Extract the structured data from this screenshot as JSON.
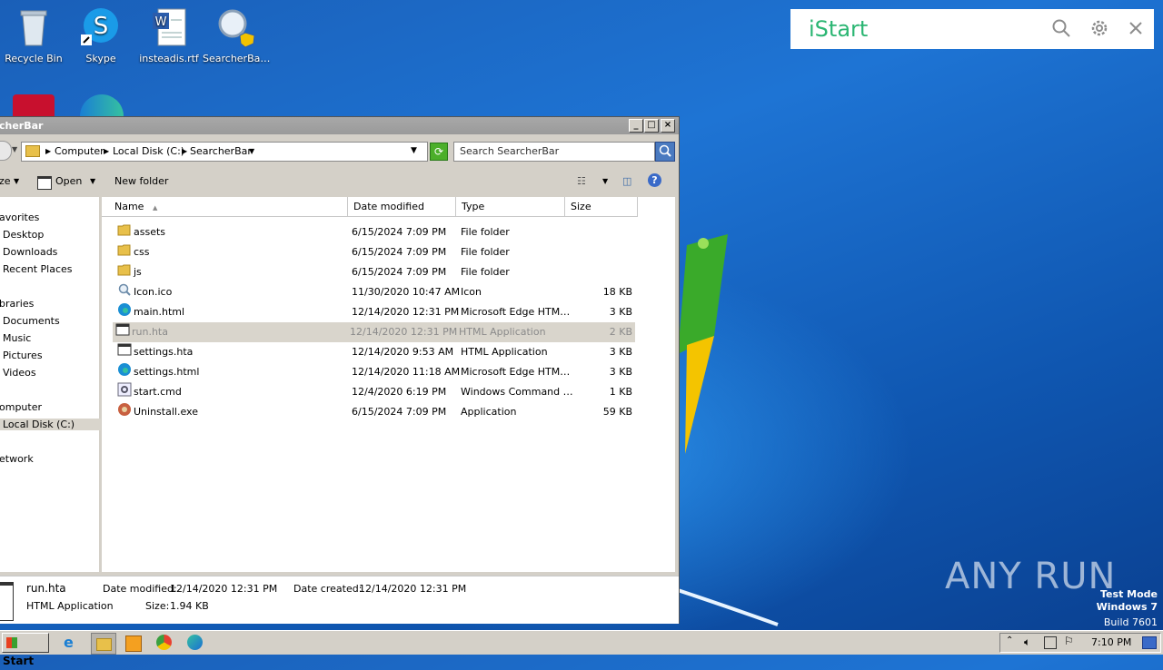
{
  "desktop": {
    "icons": [
      {
        "label": "Recycle Bin",
        "icon": "recycle-bin-icon"
      },
      {
        "label": "Skype",
        "icon": "skype-icon"
      },
      {
        "label": "insteadis.rtf",
        "icon": "word-document-icon"
      },
      {
        "label": "SearcherBa…",
        "icon": "search-shield-icon"
      }
    ]
  },
  "widget": {
    "logo": "iStart",
    "search_icon": "search-icon",
    "settings_icon": "gear-icon",
    "close_icon": "close-icon"
  },
  "window": {
    "title": "cherBar",
    "address": {
      "crumbs": [
        "Computer",
        "Local Disk (C:)",
        "SearcherBar"
      ]
    },
    "search_placeholder": "Search SearcherBar",
    "toolbar": {
      "organize": "ze",
      "open": "Open",
      "new_folder": "New folder"
    },
    "nav": [
      {
        "label": "avorites",
        "indent": false
      },
      {
        "label": "Desktop",
        "indent": true
      },
      {
        "label": "Downloads",
        "indent": true
      },
      {
        "label": "Recent Places",
        "indent": true
      },
      {
        "label": "braries",
        "indent": false
      },
      {
        "label": "Documents",
        "indent": true
      },
      {
        "label": "Music",
        "indent": true
      },
      {
        "label": "Pictures",
        "indent": true
      },
      {
        "label": "Videos",
        "indent": true
      },
      {
        "label": "omputer",
        "indent": false
      },
      {
        "label": "Local Disk (C:)",
        "indent": true,
        "selected": true
      },
      {
        "label": "etwork",
        "indent": false
      }
    ],
    "columns": {
      "name": "Name",
      "date": "Date modified",
      "type": "Type",
      "size": "Size"
    },
    "files": [
      {
        "name": "assets",
        "date": "6/15/2024 7:09 PM",
        "type": "File folder",
        "size": "",
        "icon": "folder-icon"
      },
      {
        "name": "css",
        "date": "6/15/2024 7:09 PM",
        "type": "File folder",
        "size": "",
        "icon": "folder-icon"
      },
      {
        "name": "js",
        "date": "6/15/2024 7:09 PM",
        "type": "File folder",
        "size": "",
        "icon": "folder-icon"
      },
      {
        "name": "Icon.ico",
        "date": "11/30/2020 10:47 AM",
        "type": "Icon",
        "size": "18 KB",
        "icon": "magnifier-file-icon"
      },
      {
        "name": "main.html",
        "date": "12/14/2020 12:31 PM",
        "type": "Microsoft Edge HTM…",
        "size": "3 KB",
        "icon": "edge-icon"
      },
      {
        "name": "run.hta",
        "date": "12/14/2020 12:31 PM",
        "type": "HTML Application",
        "size": "2 KB",
        "icon": "window-app-icon",
        "selected": true
      },
      {
        "name": "settings.hta",
        "date": "12/14/2020 9:53 AM",
        "type": "HTML Application",
        "size": "3 KB",
        "icon": "window-app-icon"
      },
      {
        "name": "settings.html",
        "date": "12/14/2020 11:18 AM",
        "type": "Microsoft Edge HTM…",
        "size": "3 KB",
        "icon": "edge-icon"
      },
      {
        "name": "start.cmd",
        "date": "12/4/2020 6:19 PM",
        "type": "Windows Command …",
        "size": "1 KB",
        "icon": "gear-script-icon"
      },
      {
        "name": "Uninstall.exe",
        "date": "6/15/2024 7:09 PM",
        "type": "Application",
        "size": "59 KB",
        "icon": "installer-icon"
      }
    ],
    "details": {
      "name": "run.hta",
      "type": "HTML Application",
      "modified_label": "Date modified:",
      "modified": "12/14/2020 12:31 PM",
      "created_label": "Date created:",
      "created": "12/14/2020 12:31 PM",
      "size_label": "Size:",
      "size": "1.94 KB"
    }
  },
  "watermark": {
    "brand": "ANY RUN",
    "line1": "Test Mode",
    "line2": "Windows 7",
    "line3": "Build 7601"
  },
  "taskbar": {
    "start": "Start",
    "clock": "7:10 PM"
  }
}
